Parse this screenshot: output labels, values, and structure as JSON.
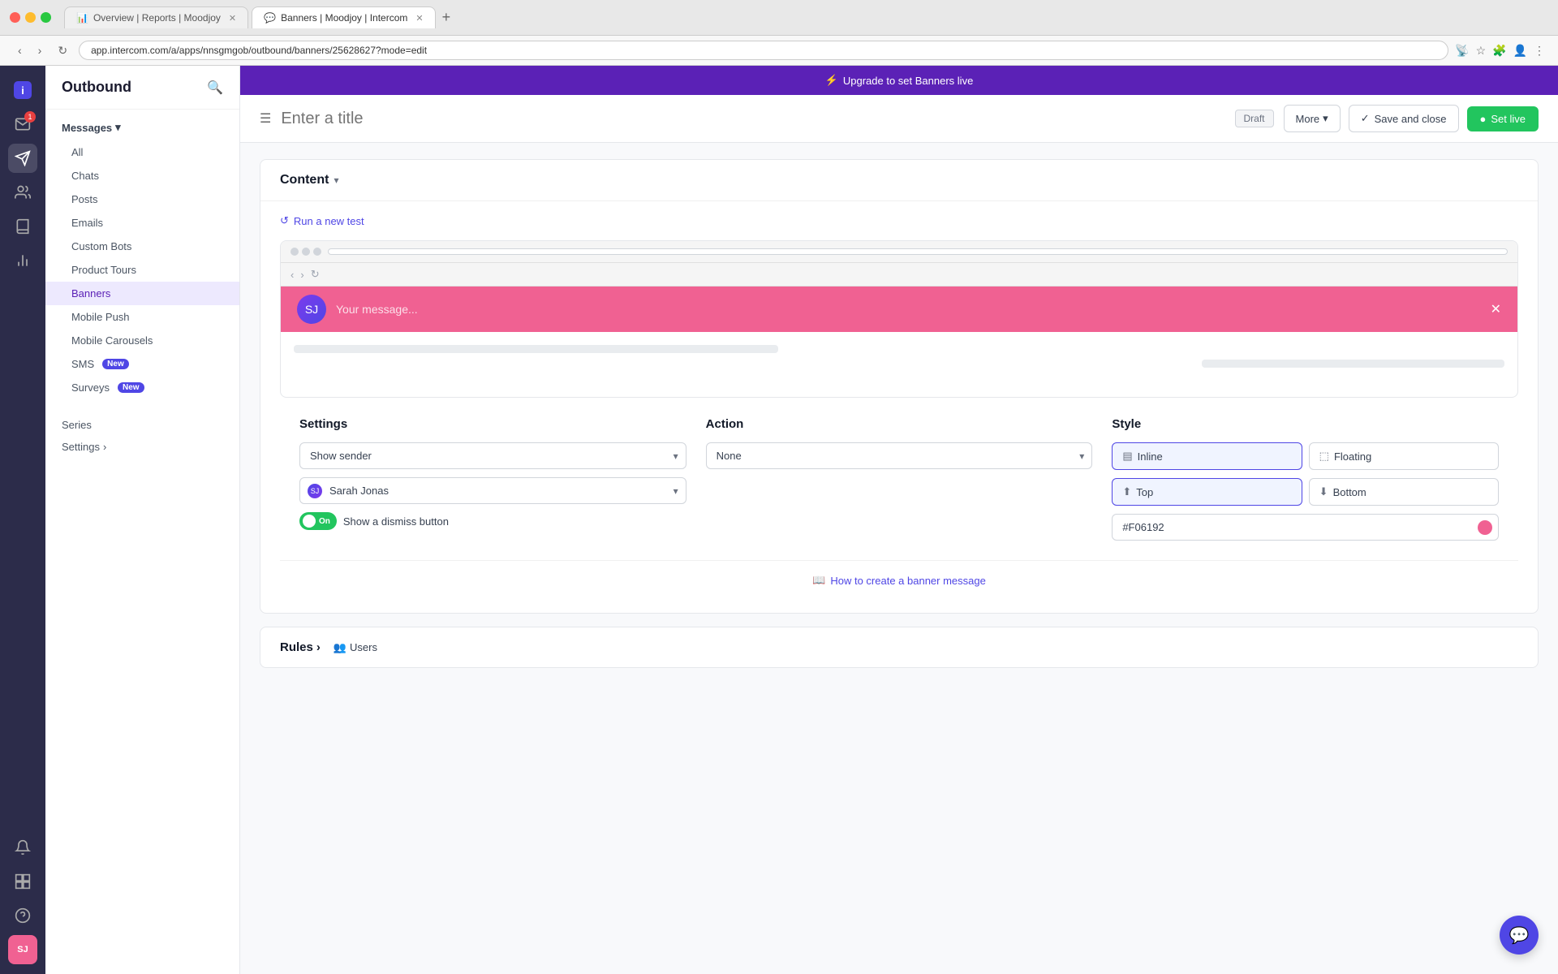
{
  "browser": {
    "tabs": [
      {
        "id": "reports",
        "label": "Overview | Reports | Moodjoy",
        "active": false,
        "icon": "📊"
      },
      {
        "id": "banners",
        "label": "Banners | Moodjoy | Intercom",
        "active": true,
        "icon": "💬"
      }
    ],
    "address": "app.intercom.com/a/apps/nnsgmgob/outbound/banners/25628627?mode=edit",
    "new_tab_label": "+"
  },
  "upgrade_banner": {
    "text": "Upgrade to set Banners live",
    "icon": "⚡"
  },
  "sidebar": {
    "title": "Outbound",
    "search_placeholder": "Search",
    "messages_label": "Messages",
    "nav_items": [
      {
        "id": "all",
        "label": "All",
        "active": false
      },
      {
        "id": "chats",
        "label": "Chats",
        "active": false
      },
      {
        "id": "posts",
        "label": "Posts",
        "active": false
      },
      {
        "id": "emails",
        "label": "Emails",
        "active": false
      },
      {
        "id": "custom-bots",
        "label": "Custom Bots",
        "active": false
      },
      {
        "id": "product-tours",
        "label": "Product Tours",
        "active": false
      },
      {
        "id": "banners",
        "label": "Banners",
        "active": true
      },
      {
        "id": "mobile-push",
        "label": "Mobile Push",
        "active": false
      },
      {
        "id": "mobile-carousels",
        "label": "Mobile Carousels",
        "active": false
      },
      {
        "id": "sms",
        "label": "SMS",
        "badge": "New",
        "active": false
      },
      {
        "id": "surveys",
        "label": "Surveys",
        "badge": "New",
        "active": false
      }
    ],
    "series_label": "Series",
    "settings_label": "Settings"
  },
  "top_bar": {
    "title_placeholder": "Enter a title",
    "draft_label": "Draft",
    "more_label": "More",
    "save_close_label": "Save and close",
    "set_live_label": "Set live"
  },
  "content_section": {
    "title": "Content",
    "run_test_label": "Run a new test",
    "banner_placeholder": "Your message...",
    "sender_name": "Sarah Jonas"
  },
  "settings_section": {
    "title": "Settings",
    "show_sender_label": "Show sender",
    "sender_name": "Sarah Jonas",
    "toggle_on_label": "On",
    "dismiss_label": "Show a dismiss button"
  },
  "action_section": {
    "title": "Action",
    "none_label": "None"
  },
  "style_section": {
    "title": "Style",
    "inline_label": "Inline",
    "floating_label": "Floating",
    "top_label": "Top",
    "bottom_label": "Bottom",
    "color_value": "#F06192"
  },
  "help_link": {
    "label": "How to create a banner message"
  },
  "rules_section": {
    "title": "Rules",
    "users_label": "Users"
  }
}
